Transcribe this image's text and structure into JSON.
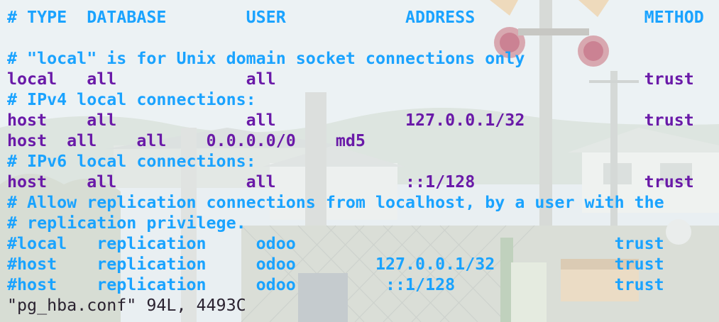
{
  "terminal": {
    "colors": {
      "comment": "#1aa3ff",
      "text": "#6a1aa8",
      "status": "#2a2230"
    },
    "lines": [
      {
        "text": "# TYPE  DATABASE        USER            ADDRESS                 METHOD",
        "kind": "comment"
      },
      {
        "text": "",
        "kind": "blank"
      },
      {
        "text": "# \"local\" is for Unix domain socket connections only",
        "kind": "comment"
      },
      {
        "text": "local   all             all                                     trust",
        "kind": "text"
      },
      {
        "text": "# IPv4 local connections:",
        "kind": "comment"
      },
      {
        "text": "host    all             all             127.0.0.1/32            trust",
        "kind": "text"
      },
      {
        "text": "host  all    all    0.0.0.0/0    md5",
        "kind": "text"
      },
      {
        "text": "# IPv6 local connections:",
        "kind": "comment"
      },
      {
        "text": "host    all             all             ::1/128                 trust",
        "kind": "text"
      },
      {
        "text": "# Allow replication connections from localhost, by a user with the",
        "kind": "comment"
      },
      {
        "text": "# replication privilege.",
        "kind": "comment"
      },
      {
        "text": "#local   replication     odoo                                trust",
        "kind": "comment"
      },
      {
        "text": "#host    replication     odoo        127.0.0.1/32            trust",
        "kind": "comment"
      },
      {
        "text": "#host    replication     odoo         ::1/128                trust",
        "kind": "comment"
      }
    ],
    "status_line": "\"pg_hba.conf\" 94L, 4493C"
  }
}
